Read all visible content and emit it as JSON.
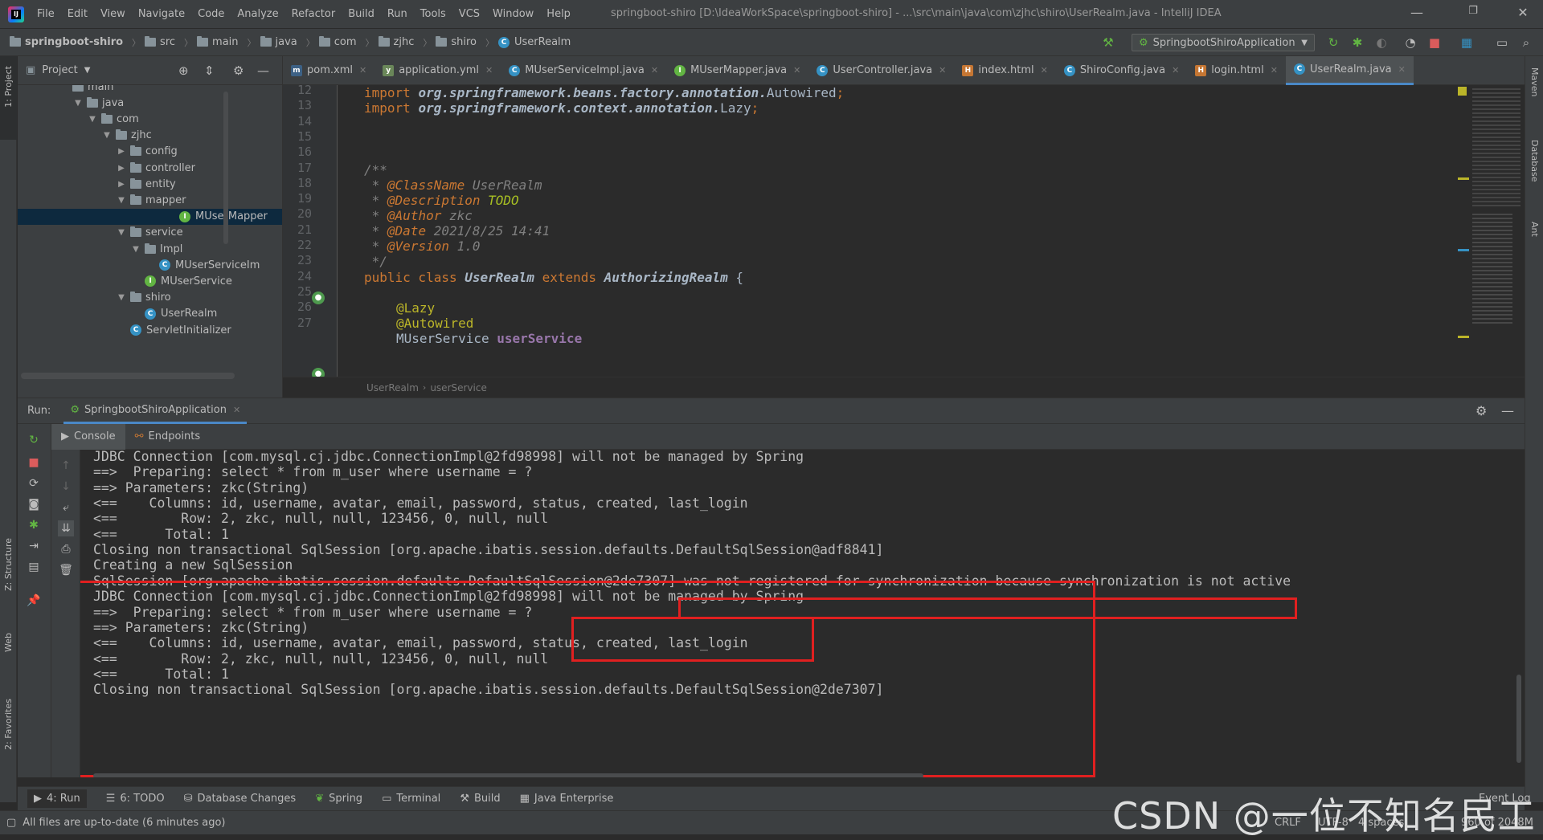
{
  "menubar": {
    "items": [
      "File",
      "Edit",
      "View",
      "Navigate",
      "Code",
      "Analyze",
      "Refactor",
      "Build",
      "Run",
      "Tools",
      "VCS",
      "Window",
      "Help"
    ],
    "title": "springboot-shiro [D:\\IdeaWorkSpace\\springboot-shiro] - ...\\src\\main\\java\\com\\zjhc\\shiro\\UserRealm.java - IntelliJ IDEA",
    "logo": "IJ"
  },
  "navbar": {
    "crumbs": [
      "springboot-shiro",
      "src",
      "main",
      "java",
      "com",
      "zjhc",
      "shiro",
      "UserRealm"
    ],
    "run_config": "SpringbootShiroApplication"
  },
  "left_strip": {
    "project": "1: Project",
    "structure": "Z: Structure",
    "web": "Web",
    "favorites": "2: Favorites"
  },
  "right_strip": {
    "maven": "Maven",
    "database": "Database",
    "ant": "Ant"
  },
  "project_panel": {
    "title": "Project",
    "items": [
      {
        "label": "main",
        "indent": 0,
        "arrow": "",
        "icon": "folder"
      },
      {
        "label": "java",
        "indent": 1,
        "arrow": "▼",
        "icon": "folder"
      },
      {
        "label": "com",
        "indent": 2,
        "arrow": "▼",
        "icon": "folder"
      },
      {
        "label": "zjhc",
        "indent": 3,
        "arrow": "▼",
        "icon": "folder"
      },
      {
        "label": "config",
        "indent": 4,
        "arrow": "▶",
        "icon": "folder"
      },
      {
        "label": "controller",
        "indent": 4,
        "arrow": "▶",
        "icon": "folder"
      },
      {
        "label": "entity",
        "indent": 4,
        "arrow": "▶",
        "icon": "folder"
      },
      {
        "label": "mapper",
        "indent": 4,
        "arrow": "▼",
        "icon": "folder"
      },
      {
        "label": "MUserMapper",
        "indent": 5,
        "arrow": "",
        "icon": "interface",
        "selected": true
      },
      {
        "label": "service",
        "indent": 4,
        "arrow": "▼",
        "icon": "folder"
      },
      {
        "label": "Impl",
        "indent": 5,
        "arrow": "▼",
        "icon": "folder"
      },
      {
        "label": "MUserServiceIm",
        "indent": 6,
        "arrow": "",
        "icon": "class"
      },
      {
        "label": "MUserService",
        "indent": 5,
        "arrow": "",
        "icon": "interface"
      },
      {
        "label": "shiro",
        "indent": 4,
        "arrow": "▼",
        "icon": "folder"
      },
      {
        "label": "UserRealm",
        "indent": 5,
        "arrow": "",
        "icon": "class"
      },
      {
        "label": "ServletInitializer",
        "indent": 4,
        "arrow": "",
        "icon": "class"
      }
    ]
  },
  "editor_tabs": [
    {
      "label": "pom.xml",
      "icon": "m",
      "color": "#3d6185"
    },
    {
      "label": "application.yml",
      "icon": "y",
      "color": "#6a8759"
    },
    {
      "label": "MUserServiceImpl.java",
      "icon": "C",
      "color": "#3592c4"
    },
    {
      "label": "MUserMapper.java",
      "icon": "I",
      "color": "#62b543"
    },
    {
      "label": "UserController.java",
      "icon": "C",
      "color": "#3592c4"
    },
    {
      "label": "index.html",
      "icon": "H",
      "color": "#c57633"
    },
    {
      "label": "ShiroConfig.java",
      "icon": "C",
      "color": "#3592c4"
    },
    {
      "label": "login.html",
      "icon": "H",
      "color": "#c57633"
    },
    {
      "label": "UserRealm.java",
      "icon": "C",
      "color": "#3592c4",
      "active": true
    }
  ],
  "editor": {
    "line_numbers": [
      "12",
      "13",
      "14",
      "15",
      "16",
      "17",
      "18",
      "19",
      "20",
      "21",
      "22",
      "23",
      "24",
      "25",
      "26",
      "27"
    ],
    "l12_kw": "import ",
    "l12_pkg": "org.springframework.beans.factory.annotation.",
    "l12_cls": "Autowired",
    "l13_kw": "import ",
    "l13_pkg": "org.springframework.context.annotation.",
    "l13_cls": "Lazy",
    "l16": "/**",
    "l17_star": " * ",
    "l17_tag": "@ClassName",
    "l17_val": " UserRealm",
    "l18_star": " * ",
    "l18_tag": "@Description",
    "l18_val": "TODO",
    "l19_star": " * ",
    "l19_tag": "@Author",
    "l19_val": " zkc",
    "l20_star": " * ",
    "l20_tag": "@Date",
    "l20_val": " 2021/8/25 14:41",
    "l21_star": " * ",
    "l21_tag": "@Version",
    "l21_val": " 1.0",
    "l22": " */",
    "l23_kw": "public class ",
    "l23_name": "UserRealm",
    "l23_ext": " extends ",
    "l23_parent": "AuthorizingRealm",
    "l23_brace": " {",
    "l25": "@Lazy",
    "l26": "@Autowired",
    "l27_type": "MUserService ",
    "l27_name": "userService",
    "breadcrumb": [
      "UserRealm",
      "userService"
    ]
  },
  "run_panel": {
    "label": "Run:",
    "config": "SpringbootShiroApplication",
    "tabs": [
      "Console",
      "Endpoints"
    ]
  },
  "console": {
    "lines": [
      "JDBC Connection [com.mysql.cj.jdbc.ConnectionImpl@2fd98998] will not be managed by Spring",
      "==>  Preparing: select * from m_user where username = ?",
      "==> Parameters: zkc(String)",
      "<==    Columns: id, username, avatar, email, password, status, created, last_login",
      "<==        Row: 2, zkc, null, null, 123456, 0, null, null",
      "<==      Total: 1",
      "Closing non transactional SqlSession [org.apache.ibatis.session.defaults.DefaultSqlSession@adf8841]",
      "Creating a new SqlSession",
      "SqlSession [org.apache.ibatis.session.defaults.DefaultSqlSession@2de7307] was not registered for synchronization because synchronization is not active",
      "JDBC Connection [com.mysql.cj.jdbc.ConnectionImpl@2fd98998] will not be managed by Spring",
      "==>  Preparing: select * from m_user where username = ?",
      "==> Parameters: zkc(String)",
      "<==    Columns: id, username, avatar, email, password, status, created, last_login",
      "<==        Row: 2, zkc, null, null, 123456, 0, null, null",
      "<==      Total: 1",
      "Closing non transactional SqlSession [org.apache.ibatis.session.defaults.DefaultSqlSession@2de7307]"
    ]
  },
  "bottom_tabs": [
    "4: Run",
    "6: TODO",
    "Database Changes",
    "Spring",
    "Terminal",
    "Build",
    "Java Enterprise"
  ],
  "status": {
    "message": "All files are up-to-date (6 minutes ago)",
    "crlf": "CRLF",
    "encoding": "UTF-8",
    "indent": "4 spaces",
    "memory": "960 of 2048M",
    "event_log": "Event Log"
  },
  "watermark": "CSDN @一位不知名民工"
}
